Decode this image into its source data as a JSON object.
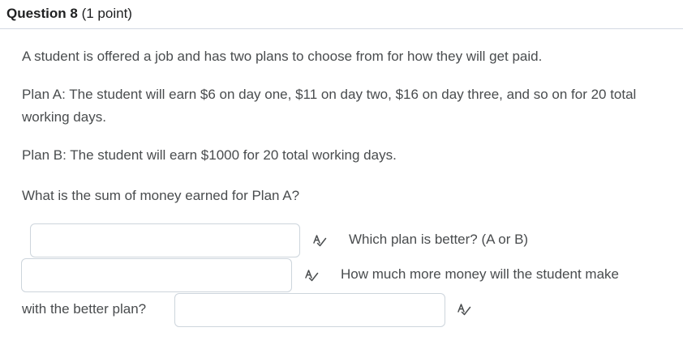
{
  "question": {
    "number_label": "Question 8",
    "points_label": "(1 point)"
  },
  "body": {
    "intro": "A student is offered a job and has two plans to choose from for how they will get paid.",
    "plan_a": "Plan A: The student will earn $6 on day one, $11 on day two, $16 on day three, and so on for 20 total working days.",
    "plan_b": "Plan B: The student will earn $1000 for 20 total working days.",
    "prompt_sum": "What is the sum of money earned for Plan A?"
  },
  "answers": {
    "field_1_value": "",
    "field_2_value": "",
    "field_3_value": "",
    "text_after_field_1": "Which plan is better?  (A or B)",
    "text_after_field_2": "How much more money will the student make",
    "text_before_field_3": "with the better plan?"
  },
  "icons": {
    "spellcheck": "spellcheck-icon"
  },
  "colors": {
    "text": "#494c4e",
    "title": "#202122",
    "border": "#cdd5dc"
  }
}
